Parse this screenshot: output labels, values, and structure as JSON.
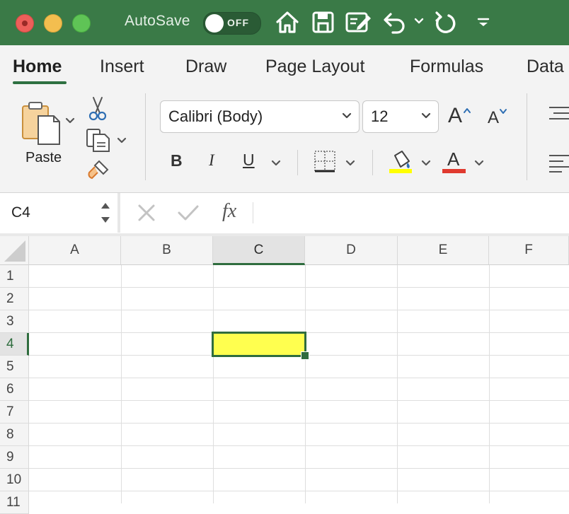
{
  "titlebar": {
    "autosave_label": "AutoSave",
    "autosave_state": "OFF",
    "icons": [
      "home-icon",
      "save-icon",
      "edit-document-icon",
      "undo-icon",
      "chevron-down-icon",
      "redo-icon",
      "customize-toolbar-icon"
    ]
  },
  "ribbon_tabs": [
    {
      "label": "Home",
      "active": true
    },
    {
      "label": "Insert"
    },
    {
      "label": "Draw"
    },
    {
      "label": "Page Layout"
    },
    {
      "label": "Formulas"
    },
    {
      "label": "Data"
    }
  ],
  "ribbon": {
    "paste_label": "Paste",
    "font_name": "Calibri (Body)",
    "font_size": "12",
    "increase_font_label": "A",
    "decrease_font_label": "A",
    "bold_label": "B",
    "italic_label": "I",
    "underline_label": "U",
    "font_color_label": "A",
    "fill_color": "#ffff00",
    "font_color": "#e03a2f"
  },
  "formula_bar": {
    "name_box": "C4",
    "fx_label": "fx",
    "formula": ""
  },
  "grid": {
    "columns": [
      "A",
      "B",
      "C",
      "D",
      "E",
      "F"
    ],
    "rows": [
      "1",
      "2",
      "3",
      "4",
      "5",
      "6",
      "7",
      "8",
      "9",
      "10",
      "11"
    ],
    "selected_column": "C",
    "selected_row": "4",
    "selected_cell_fill": "#ffff4f",
    "accent": "#2f6d3e"
  }
}
